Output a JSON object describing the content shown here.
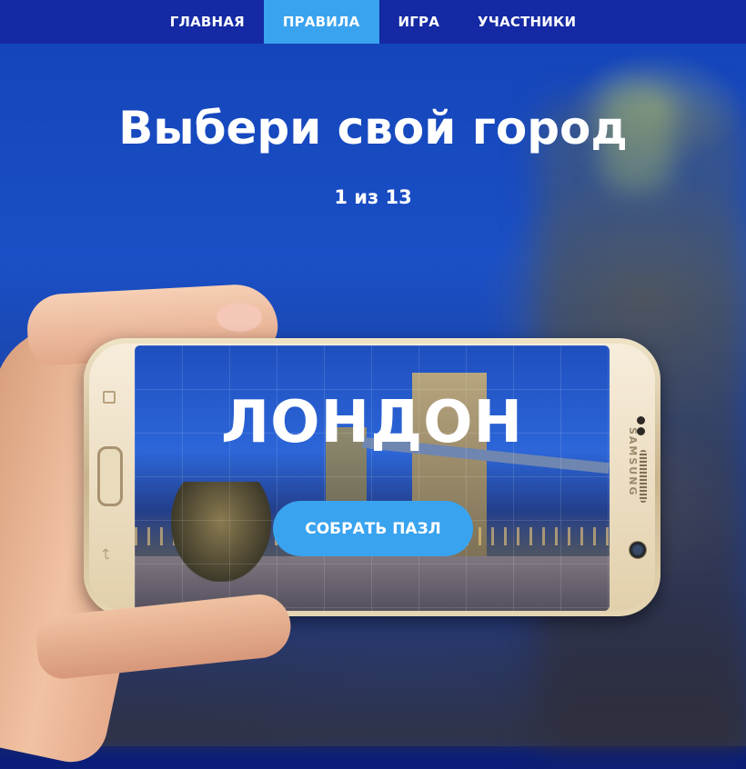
{
  "nav": {
    "items": [
      {
        "label": "ГЛАВНАЯ",
        "active": false
      },
      {
        "label": "ПРАВИЛА",
        "active": true
      },
      {
        "label": "ИГРА",
        "active": false
      },
      {
        "label": "УЧАСТНИКИ",
        "active": false
      }
    ]
  },
  "hero": {
    "title": "Выбери свой город",
    "counter": "1 из 13"
  },
  "card": {
    "city_name": "ЛОНДОН",
    "button_label": "СОБРАТЬ ПАЗЛ"
  },
  "phone": {
    "brand": "SAMSUNG"
  },
  "colors": {
    "nav_bg": "#1429a3",
    "accent": "#3aa3ef",
    "text": "#ffffff"
  },
  "icons": [
    "recent-apps-icon",
    "home-button",
    "back-icon",
    "front-camera-icon"
  ]
}
